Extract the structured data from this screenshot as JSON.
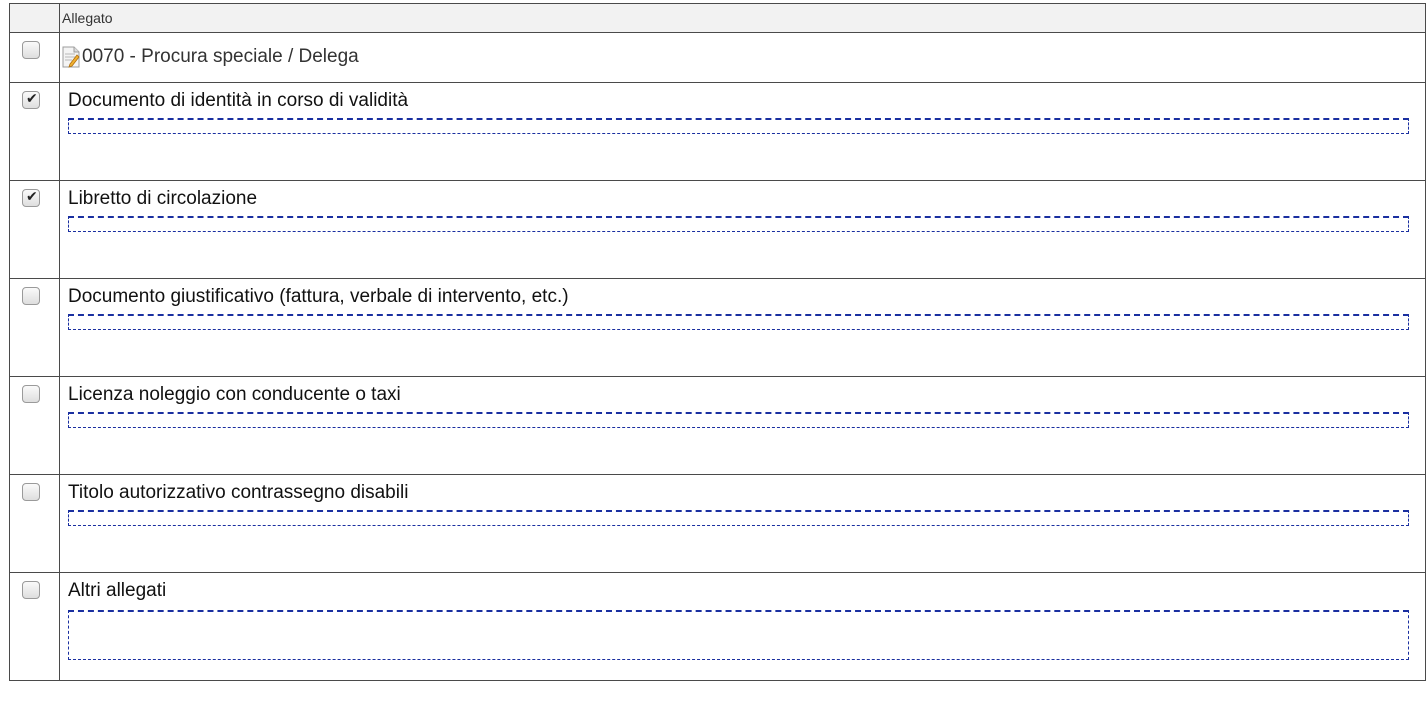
{
  "header": {
    "column_label": "Allegato"
  },
  "first_row": {
    "checked": false,
    "icon": "document-edit-icon",
    "label": "0070 - Procura speciale / Delega"
  },
  "attachments": [
    {
      "label": "Documento di identità in corso di validità",
      "checked": true
    },
    {
      "label": "Libretto di circolazione",
      "checked": true
    },
    {
      "label": "Documento giustificativo (fattura, verbale di intervento, etc.)",
      "checked": false
    },
    {
      "label": "Licenza noleggio con conducente o taxi",
      "checked": false
    },
    {
      "label": "Titolo autorizzativo contrassegno disabili",
      "checked": false
    },
    {
      "label": "Altri allegati",
      "checked": false
    }
  ],
  "colors": {
    "border": "#4a4a4a",
    "note_border": "#1a2fa0",
    "header_bg": "#f2f2f2"
  }
}
